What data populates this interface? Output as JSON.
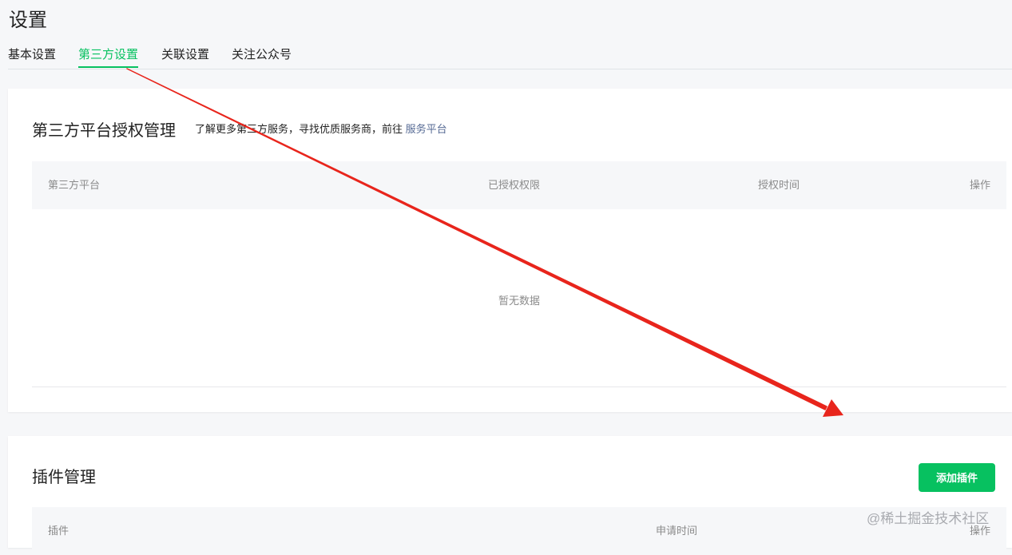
{
  "page": {
    "title": "设置"
  },
  "tabs": [
    {
      "label": "基本设置",
      "active": false
    },
    {
      "label": "第三方设置",
      "active": true
    },
    {
      "label": "关联设置",
      "active": false
    },
    {
      "label": "关注公众号",
      "active": false
    }
  ],
  "third_party": {
    "title": "第三方平台授权管理",
    "description": "了解更多第三方服务，寻找优质服务商，前往",
    "link_label": "服务平台",
    "columns": [
      "第三方平台",
      "已授权权限",
      "授权时间",
      "操作"
    ],
    "empty_text": "暂无数据"
  },
  "plugins": {
    "title": "插件管理",
    "add_button": "添加插件",
    "columns": [
      "插件",
      "申请时间",
      "操作"
    ]
  },
  "watermark": "@稀土掘金技术社区",
  "colors": {
    "accent": "#07c160",
    "link": "#576b95",
    "annotation_arrow": "#e8251c"
  }
}
